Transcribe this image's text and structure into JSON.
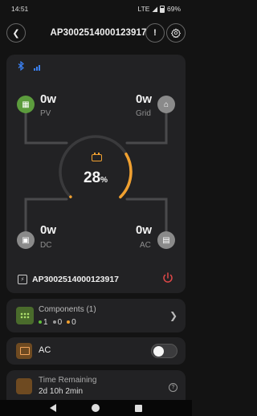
{
  "status_bar": {
    "time": "14:51",
    "network": "LTE",
    "battery": "69%"
  },
  "header": {
    "title": "AP3002514000123917"
  },
  "main": {
    "pv": {
      "value": "0w",
      "label": "PV"
    },
    "grid": {
      "value": "0w",
      "label": "Grid"
    },
    "dc": {
      "value": "0w",
      "label": "DC"
    },
    "ac": {
      "value": "0w",
      "label": "AC"
    },
    "battery_percent": "28",
    "battery_unit": "%",
    "battery_level": 0.28,
    "device_id": "AP3002514000123917"
  },
  "components": {
    "title": "Components (1)",
    "stats": [
      {
        "value": "1",
        "color": "#5fbf3a"
      },
      {
        "value": "0",
        "color": "#9a9a9a"
      },
      {
        "value": "0",
        "color": "#f0a030"
      }
    ]
  },
  "ac_toggle": {
    "label": "AC",
    "on": false
  },
  "time_remaining": {
    "label": "Time Remaining",
    "value": "2d 10h 2min"
  },
  "colors": {
    "accent": "#f0a030",
    "pv_active": "#5c9c3d",
    "bluetooth": "#3b82f6",
    "power": "#e04848"
  }
}
